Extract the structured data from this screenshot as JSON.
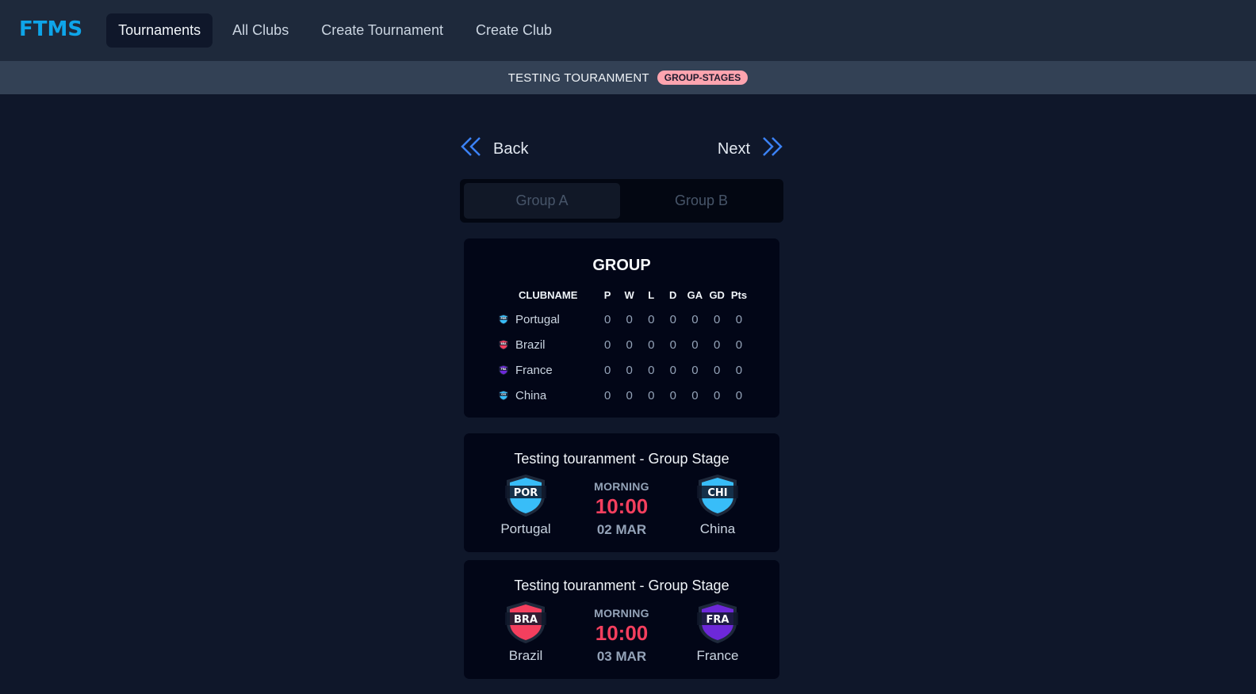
{
  "app": {
    "logo": "FTMS"
  },
  "nav": {
    "items": [
      {
        "label": "Tournaments",
        "active": true
      },
      {
        "label": "All Clubs",
        "active": false
      },
      {
        "label": "Create Tournament",
        "active": false
      },
      {
        "label": "Create Club",
        "active": false
      }
    ]
  },
  "tournament": {
    "name": "TESTING TOURANMENT",
    "stage": "GROUP-STAGES"
  },
  "pager": {
    "back_label": "Back",
    "next_label": "Next"
  },
  "group_tabs": [
    {
      "label": "Group A",
      "active": true
    },
    {
      "label": "Group B",
      "active": false
    }
  ],
  "standings": {
    "title": "GROUP",
    "columns": [
      "CLUBNAME",
      "P",
      "W",
      "L",
      "D",
      "GA",
      "GD",
      "Pts"
    ],
    "rows": [
      {
        "club": "Portugal",
        "abbr": "POR",
        "color": "#38bdf8",
        "stats": [
          "0",
          "0",
          "0",
          "0",
          "0",
          "0",
          "0"
        ]
      },
      {
        "club": "Brazil",
        "abbr": "BRA",
        "color": "#f43f5e",
        "stats": [
          "0",
          "0",
          "0",
          "0",
          "0",
          "0",
          "0"
        ]
      },
      {
        "club": "France",
        "abbr": "FRA",
        "color": "#6d28d9",
        "stats": [
          "0",
          "0",
          "0",
          "0",
          "0",
          "0",
          "0"
        ]
      },
      {
        "club": "China",
        "abbr": "CHI",
        "color": "#38bdf8",
        "stats": [
          "0",
          "0",
          "0",
          "0",
          "0",
          "0",
          "0"
        ]
      }
    ]
  },
  "matches": [
    {
      "title": "Testing touranment - Group Stage",
      "home": {
        "name": "Portugal",
        "abbr": "POR",
        "color": "#38bdf8"
      },
      "away": {
        "name": "China",
        "abbr": "CHI",
        "color": "#38bdf8"
      },
      "period": "MORNING",
      "time": "10:00",
      "date": "02 MAR"
    },
    {
      "title": "Testing touranment - Group Stage",
      "home": {
        "name": "Brazil",
        "abbr": "BRA",
        "color": "#f43f5e"
      },
      "away": {
        "name": "France",
        "abbr": "FRA",
        "color": "#6d28d9"
      },
      "period": "MORNING",
      "time": "10:00",
      "date": "03 MAR"
    }
  ],
  "icons": {
    "back": "double-chevron-left-icon",
    "next": "double-chevron-right-icon",
    "club_crest": "shield-crest-icon"
  },
  "colors": {
    "accent": "#3b82f6",
    "logo": "#0ea5e9",
    "time": "#f43f5e",
    "badge": "#fda4af"
  }
}
